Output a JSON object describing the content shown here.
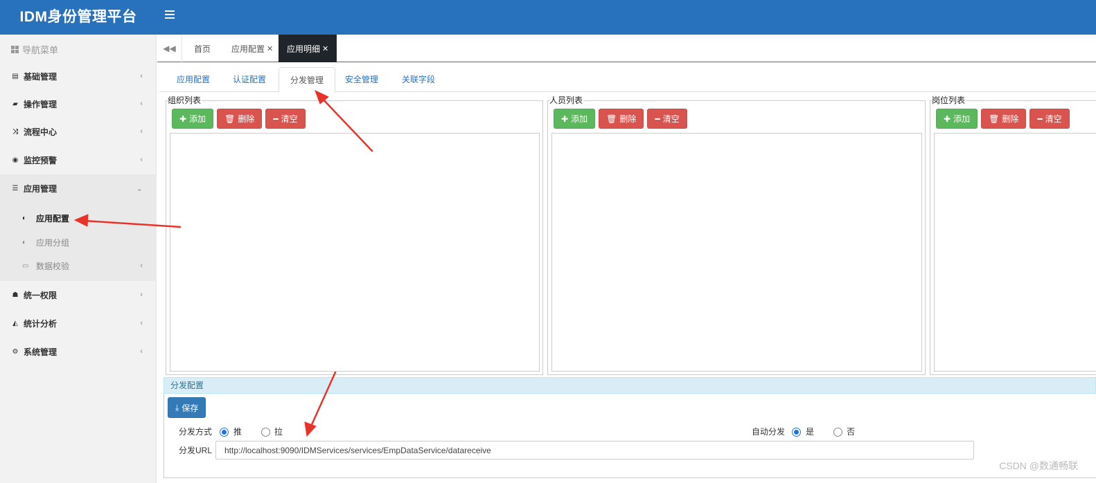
{
  "header": {
    "brand": "IDM身份管理平台",
    "menu_icon": "hamburger-icon"
  },
  "sidebar": {
    "title": "导航菜单",
    "items": [
      {
        "label": "基础管理",
        "icon": "id-card-icon"
      },
      {
        "label": "操作管理",
        "icon": "book-icon"
      },
      {
        "label": "流程中心",
        "icon": "shuffle-icon"
      },
      {
        "label": "监控预警",
        "icon": "eye-icon"
      },
      {
        "label": "应用管理",
        "icon": "list-icon",
        "expanded": true
      },
      {
        "label": "统一权限",
        "icon": "sitemap-icon"
      },
      {
        "label": "统计分析",
        "icon": "area-chart-icon"
      },
      {
        "label": "系统管理",
        "icon": "gears-icon"
      }
    ],
    "sub_items": [
      {
        "label": "应用配置",
        "icon": "leaf-icon",
        "active": true
      },
      {
        "label": "应用分组",
        "icon": "leaf-icon"
      },
      {
        "label": "数据校验",
        "icon": "folder-icon"
      }
    ]
  },
  "page_tabs": [
    {
      "label": "首页",
      "closable": false
    },
    {
      "label": "应用配置",
      "closable": true
    },
    {
      "label": "应用明细",
      "closable": true,
      "active": true
    }
  ],
  "inner_tabs": [
    {
      "label": "应用配置"
    },
    {
      "label": "认证配置"
    },
    {
      "label": "分发管理",
      "active": true
    },
    {
      "label": "安全管理"
    },
    {
      "label": "关联字段"
    }
  ],
  "panels": [
    {
      "title": "组织列表"
    },
    {
      "title": "人员列表"
    },
    {
      "title": "岗位列表"
    }
  ],
  "buttons": {
    "add": "添加",
    "delete": "删除",
    "clear": "清空",
    "save": "保存"
  },
  "config": {
    "title": "分发配置",
    "method_label": "分发方式",
    "method_options": [
      "推",
      "拉"
    ],
    "method_selected": "推",
    "auto_label": "自动分发",
    "auto_options": [
      "是",
      "否"
    ],
    "auto_selected": "是",
    "url_label": "分发URL",
    "url_value": "http://localhost:9090/IDMServices/services/EmpDataService/datareceive"
  },
  "colors": {
    "primary": "#2771bd",
    "success": "#5cb85c",
    "danger": "#d9534f",
    "info_bg": "#d9edf7",
    "annotation": "#e8332a"
  },
  "watermark": "CSDN @数通畅联"
}
